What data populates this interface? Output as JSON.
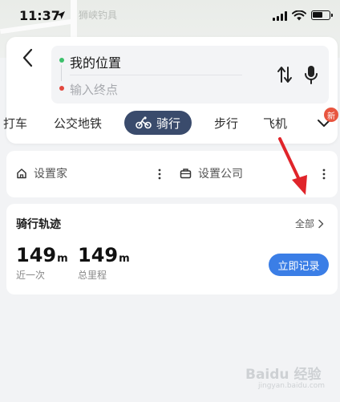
{
  "status_bar": {
    "time": "11:37"
  },
  "map": {
    "label": "狮峡钓具"
  },
  "route": {
    "from": "我的位置",
    "to_placeholder": "输入终点"
  },
  "tabs": {
    "items": [
      "打车",
      "公交地铁",
      "骑行",
      "步行",
      "飞机"
    ],
    "active_index": 2,
    "new_badge": "新"
  },
  "places": {
    "home": "设置家",
    "company": "设置公司"
  },
  "track": {
    "title": "骑行轨迹",
    "all_link": "全部",
    "stats": [
      {
        "value": "149",
        "unit": "m",
        "label": "近一次"
      },
      {
        "value": "149",
        "unit": "m",
        "label": "总里程"
      }
    ],
    "record_button": "立即记录"
  },
  "watermark": {
    "text": "Baidu 经验",
    "sub": "jingyan.baidu.com"
  },
  "colors": {
    "active_tab": "#3a4b6c",
    "record_button": "#3b7ee6",
    "start_dot": "#3cc06b",
    "end_dot": "#e2473e",
    "badge": "#e8553f",
    "annotation_arrow": "#e0242a"
  }
}
